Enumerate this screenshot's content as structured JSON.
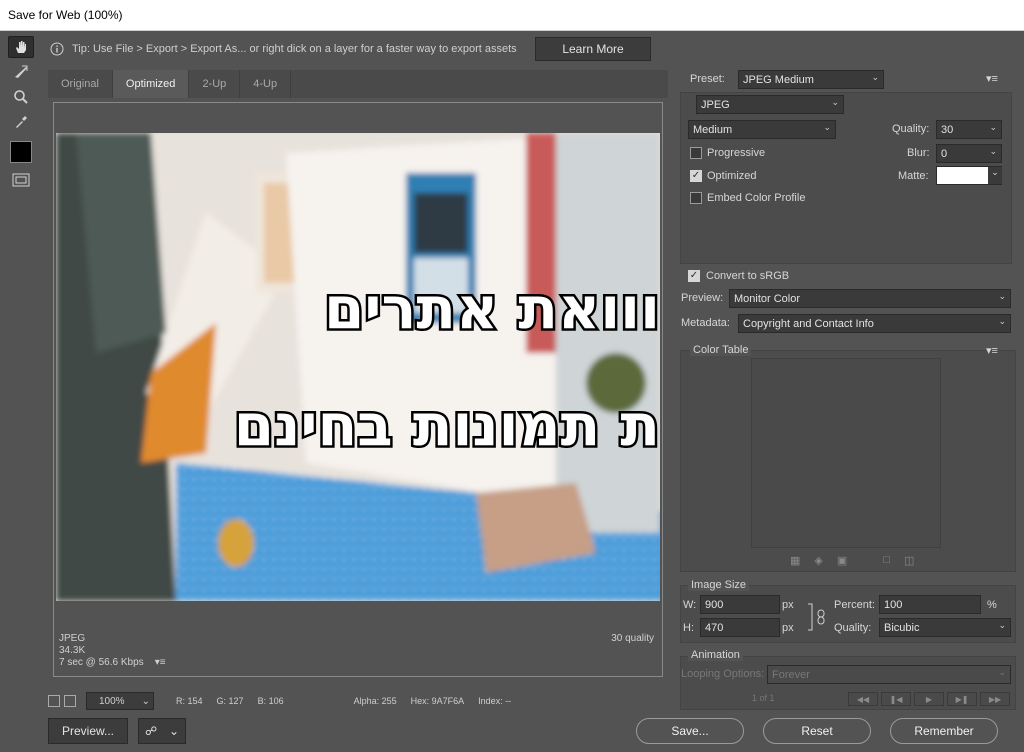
{
  "window": {
    "title": "Save for Web (100%)"
  },
  "tip": {
    "text": "Tip: Use File > Export > Export As...  or right dick on a layer for a faster way to export assets",
    "learn_more": "Learn More"
  },
  "view_tabs": [
    "Original",
    "Optimized",
    "2-Up",
    "4-Up"
  ],
  "image": {
    "line1": "ווואת אתרים",
    "line2": "ת תמונות בחינם"
  },
  "image_info": {
    "format": "JPEG",
    "size": "34.3K",
    "time": "7 sec @ 56.6 Kbps",
    "quality": "30 quality"
  },
  "status": {
    "zoom": "100%",
    "r": "R: 154",
    "g": "G: 127",
    "b": "B: 106",
    "alpha": "Alpha: 255",
    "hex": "Hex: 9A7F6A",
    "index": "Index: --"
  },
  "buttons": {
    "preview": "Preview...",
    "save": "Save...",
    "reset": "Reset",
    "remember": "Remember"
  },
  "settings": {
    "preset_label": "Preset:",
    "preset": "JPEG Medium",
    "format": "JPEG",
    "quality_level": "Medium",
    "quality_label": "Quality:",
    "quality": "30",
    "progressive": "Progressive",
    "blur_label": "Blur:",
    "blur": "0",
    "optimized": "Optimized",
    "matte_label": "Matte:",
    "embed_profile": "Embed Color Profile",
    "convert_srgb": "Convert to sRGB",
    "preview_label": "Preview:",
    "preview": "Monitor Color",
    "metadata_label": "Metadata:",
    "metadata": "Copyright and Contact Info"
  },
  "color_table": {
    "title": "Color Table"
  },
  "image_size": {
    "title": "Image Size",
    "w_label": "W:",
    "w": "900",
    "w_unit": "px",
    "h_label": "H:",
    "h": "470",
    "h_unit": "px",
    "percent_label": "Percent:",
    "percent": "100",
    "percent_unit": "%",
    "quality_label": "Quality:",
    "quality": "Bicubic"
  },
  "animation": {
    "title": "Animation",
    "looping_label": "Looping Options:",
    "looping": "Forever",
    "frame": "1 of 1"
  },
  "colors": {
    "panel_bg": "#535353",
    "field_bg": "#3a3a3a",
    "pool": "#2b8fd4"
  }
}
